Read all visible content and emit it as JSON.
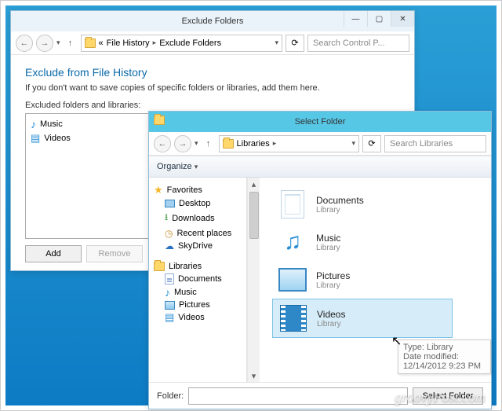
{
  "win1": {
    "title": "Exclude Folders",
    "breadcrumb": {
      "a": "File History",
      "b": "Exclude Folders"
    },
    "search_placeholder": "Search Control P...",
    "heading": "Exclude from File History",
    "desc": "If you don't want to save copies of specific folders or libraries, add them here.",
    "list_label": "Excluded folders and libraries:",
    "items": [
      {
        "name": "Music"
      },
      {
        "name": "Videos"
      }
    ],
    "add": "Add",
    "remove": "Remove"
  },
  "win2": {
    "title": "Select Folder",
    "breadcrumb": {
      "a": "Libraries"
    },
    "search_placeholder": "Search Libraries",
    "organize": "Organize",
    "sidebar": {
      "favorites": "Favorites",
      "fav": [
        "Desktop",
        "Downloads",
        "Recent places",
        "SkyDrive"
      ],
      "libraries": "Libraries",
      "libs": [
        "Documents",
        "Music",
        "Pictures",
        "Videos"
      ]
    },
    "entries": [
      {
        "name": "Documents",
        "type": "Library"
      },
      {
        "name": "Music",
        "type": "Library"
      },
      {
        "name": "Pictures",
        "type": "Library"
      },
      {
        "name": "Videos",
        "type": "Library"
      }
    ],
    "tooltip": {
      "l1": "Type: Library",
      "l2": "Date modified: 12/14/2012 9:23 PM"
    },
    "folder_label": "Folder:",
    "select_btn": "Select Folder"
  },
  "watermark": "groovyPost.com"
}
